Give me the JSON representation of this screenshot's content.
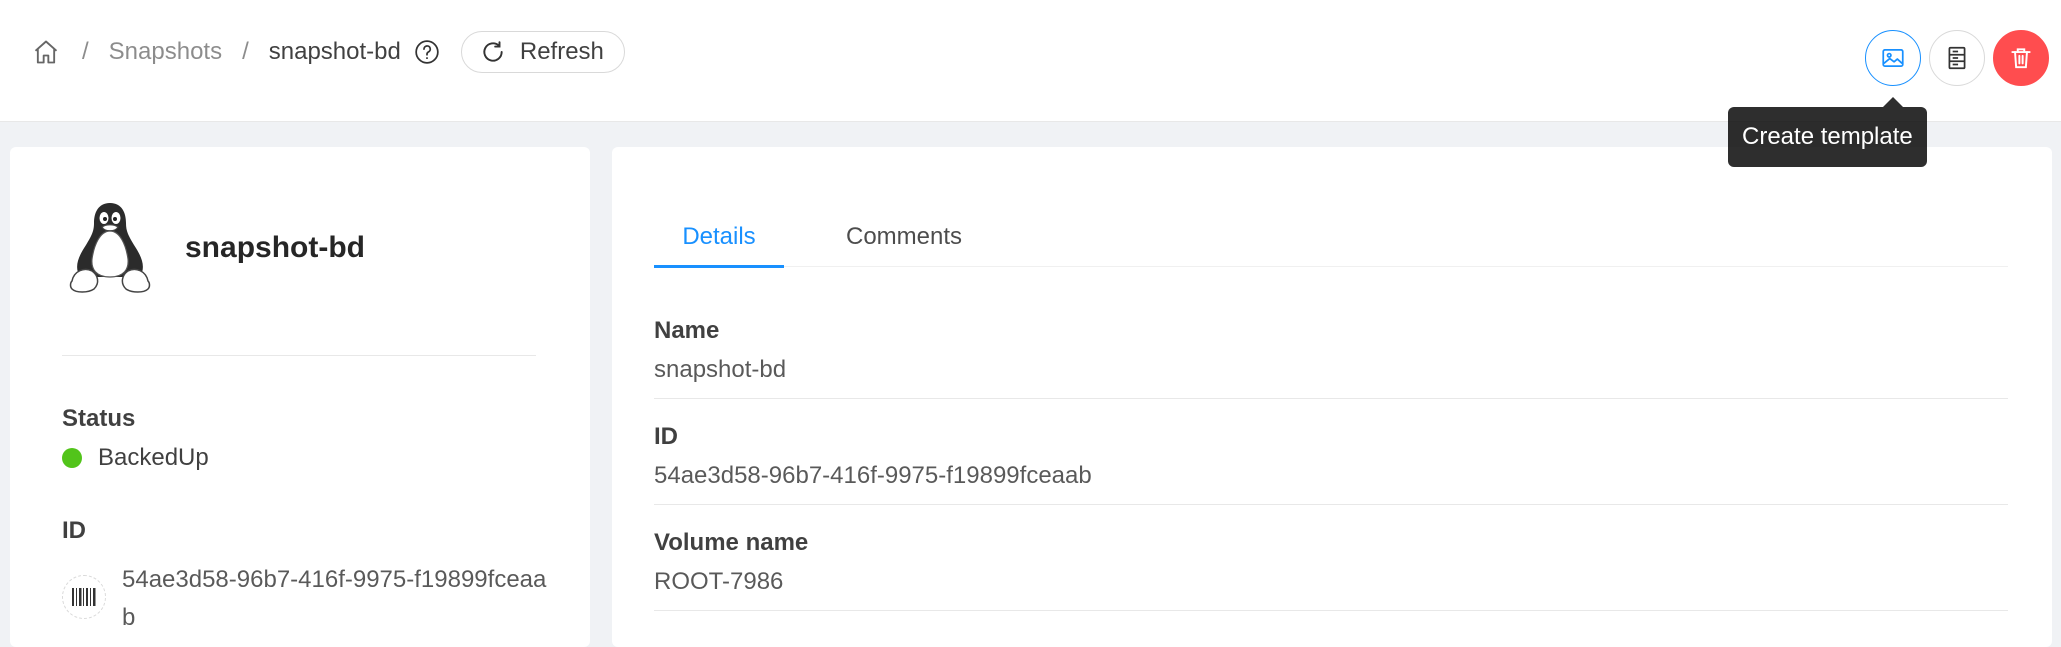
{
  "breadcrumb": {
    "separator": "/",
    "section": "Snapshots",
    "current": "snapshot-bd"
  },
  "toolbar": {
    "refresh_label": "Refresh",
    "tooltip": "Create template",
    "colors": {
      "primary": "#1890ff",
      "danger": "#ff4d4f"
    }
  },
  "resource": {
    "name": "snapshot-bd",
    "status_label": "Status",
    "status_value": "BackedUp",
    "status_color": "#52c41a",
    "id_label": "ID",
    "id_value": "54ae3d58-96b7-416f-9975-f19899fceaab"
  },
  "tabs": [
    {
      "label": "Details",
      "active": true
    },
    {
      "label": "Comments",
      "active": false
    }
  ],
  "details": [
    {
      "label": "Name",
      "value": "snapshot-bd"
    },
    {
      "label": "ID",
      "value": "54ae3d58-96b7-416f-9975-f19899fceaab"
    },
    {
      "label": "Volume name",
      "value": "ROOT-7986"
    }
  ]
}
